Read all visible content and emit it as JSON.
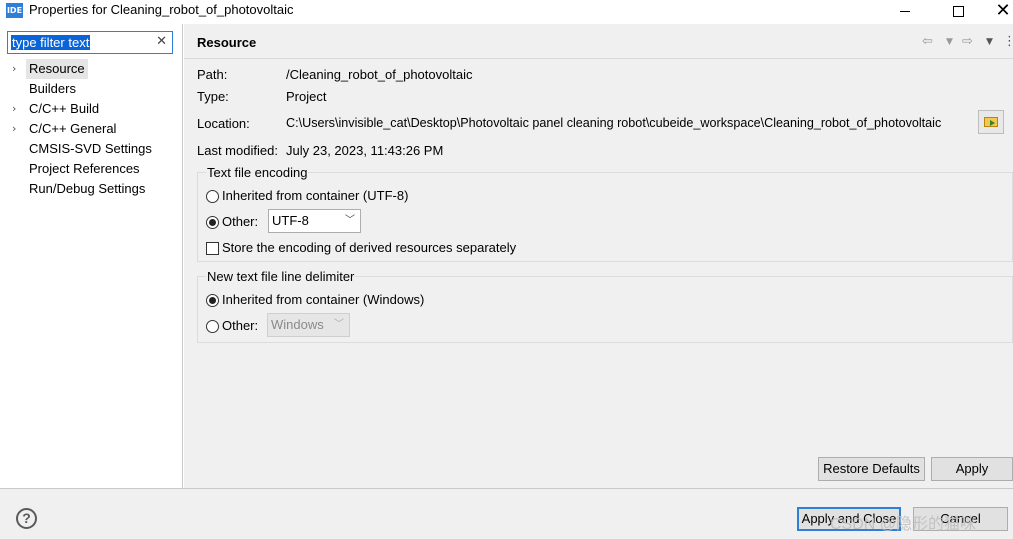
{
  "window": {
    "icon_text": "IDE",
    "title": "Properties for Cleaning_robot_of_photovoltaic",
    "minimize": "—",
    "close": "✕"
  },
  "filter": {
    "text": "type filter text",
    "clear": "✕"
  },
  "tree": {
    "items": [
      {
        "label": "Resource",
        "has_children": true,
        "selected": true
      },
      {
        "label": "Builders",
        "has_children": false,
        "selected": false
      },
      {
        "label": "C/C++ Build",
        "has_children": true,
        "selected": false
      },
      {
        "label": "C/C++ General",
        "has_children": true,
        "selected": false
      },
      {
        "label": "CMSIS-SVD Settings",
        "has_children": false,
        "selected": false
      },
      {
        "label": "Project References",
        "has_children": false,
        "selected": false
      },
      {
        "label": "Run/Debug Settings",
        "has_children": false,
        "selected": false
      }
    ]
  },
  "section": {
    "title": "Resource"
  },
  "props": {
    "path_label": "Path:",
    "path_value": "/Cleaning_robot_of_photovoltaic",
    "type_label": "Type:",
    "type_value": "Project",
    "location_label": "Location:",
    "location_value": "C:\\Users\\invisible_cat\\Desktop\\Photovoltaic panel cleaning robot\\cubeide_workspace\\Cleaning_robot_of_photovoltaic",
    "modified_label": "Last modified:",
    "modified_value": "July 23, 2023, 11:43:26 PM"
  },
  "encoding": {
    "title": "Text file encoding",
    "inherited_label": "Inherited from container (UTF-8)",
    "other_label": "Other:",
    "other_value": "UTF-8",
    "store_label": "Store the encoding of derived resources separately"
  },
  "delimiter": {
    "title": "New text file line delimiter",
    "inherited_label": "Inherited from container (Windows)",
    "other_label": "Other:",
    "other_value": "Windows"
  },
  "buttons": {
    "restore_defaults": "Restore Defaults",
    "apply": "Apply",
    "apply_and_close": "Apply and Close",
    "cancel": "Cancel"
  },
  "help": "?",
  "watermark": "CSDN @隐形的猫咪"
}
